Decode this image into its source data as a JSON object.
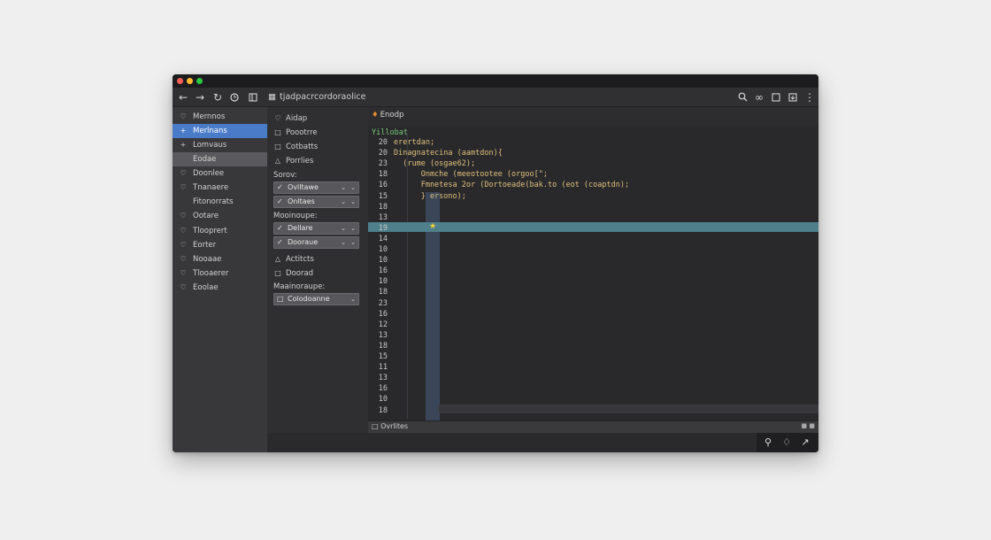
{
  "colors": {
    "accent": "#4a7bc8",
    "highlight_row": "#4e7f8a",
    "path_green": "#7ac873",
    "code_yellow": "#e0c07a",
    "star": "#f3d23a"
  },
  "toolbar": {
    "back_icon": "arrow-left-icon",
    "forward_icon": "arrow-right-icon",
    "reload_icon": "reload-icon",
    "history_icon": "clock-icon",
    "sidebar_icon": "sidebar-icon",
    "address_icon": "file-icon",
    "address": "tjadpacrcordoraolice",
    "right_icons": [
      "search-icon",
      "wand-icon",
      "square-icon",
      "download-icon",
      "more-icon"
    ]
  },
  "sidebar": {
    "items": [
      {
        "icon": "heart-icon",
        "label": "Mernnos"
      },
      {
        "icon": "plus-icon",
        "label": "Merlnans"
      },
      {
        "icon": "plus-icon",
        "label": "Lomvaus"
      },
      {
        "icon": "none",
        "label": "Eodae"
      },
      {
        "icon": "heart-icon",
        "label": "Doonlee"
      },
      {
        "icon": "heart-icon",
        "label": "Tnanaere"
      },
      {
        "icon": "none",
        "label": "Fitonorrats"
      },
      {
        "icon": "heart-icon",
        "label": "Ootare"
      },
      {
        "icon": "heart-icon",
        "label": "Tlooprert"
      },
      {
        "icon": "heart-icon",
        "label": "Eorter"
      },
      {
        "icon": "heart-icon",
        "label": "Nooaae"
      },
      {
        "icon": "heart-icon",
        "label": "Tlooaerer"
      },
      {
        "icon": "heart-icon",
        "label": "Eoolae"
      }
    ]
  },
  "panel": {
    "items": [
      {
        "icon": "heart-icon",
        "label": "Aidap"
      },
      {
        "icon": "doc-icon",
        "label": "Poootrre"
      },
      {
        "icon": "doc-icon",
        "label": "Cotbatts"
      },
      {
        "icon": "triangle-icon",
        "label": "Porrlies"
      }
    ],
    "section1": "Sorov:",
    "selects1": [
      {
        "value": "Ovlltawe"
      },
      {
        "value": "Onltaes"
      }
    ],
    "section2": "Mooinoupe:",
    "selects2": [
      {
        "value": "Dellare"
      },
      {
        "value": "Dooraue"
      }
    ],
    "items2": [
      {
        "icon": "triangle-icon",
        "label": "Actitcts"
      },
      {
        "icon": "doc-icon",
        "label": "Doorad"
      }
    ],
    "section3": "Maainoraupe:",
    "select3": {
      "value": "Colodoanne"
    }
  },
  "editor": {
    "tab": "Enodp",
    "path": "Yillobat",
    "lines": [
      {
        "n": "20",
        "code": "erertdan;"
      },
      {
        "n": "20",
        "code": "Dinagnatecina (aamtdon){"
      },
      {
        "n": "23",
        "code": "  (rume (osgae62);"
      },
      {
        "n": "18",
        "code": "      Onmche (meeotootee (orgoo[\";"
      },
      {
        "n": "16",
        "code": "      Fmnetesa 2or (Dortoeade(bak.to (eot (coaptdn);"
      },
      {
        "n": "15",
        "code": "      } ersono);"
      },
      {
        "n": "18",
        "code": ""
      },
      {
        "n": "13",
        "code": ""
      },
      {
        "n": "19",
        "code": ""
      },
      {
        "n": "14",
        "code": ""
      },
      {
        "n": "10",
        "code": ""
      },
      {
        "n": "10",
        "code": ""
      },
      {
        "n": "16",
        "code": ""
      },
      {
        "n": "10",
        "code": ""
      },
      {
        "n": "18",
        "code": ""
      },
      {
        "n": "23",
        "code": ""
      },
      {
        "n": "16",
        "code": ""
      },
      {
        "n": "12",
        "code": ""
      },
      {
        "n": "13",
        "code": ""
      },
      {
        "n": "18",
        "code": ""
      },
      {
        "n": "15",
        "code": ""
      },
      {
        "n": "11",
        "code": ""
      },
      {
        "n": "13",
        "code": ""
      },
      {
        "n": "16",
        "code": ""
      },
      {
        "n": "10",
        "code": ""
      },
      {
        "n": "18",
        "code": ""
      }
    ],
    "status_label": "Ovrlites"
  },
  "statusbar": {
    "icons": [
      "person-icon",
      "bell-icon",
      "share-icon"
    ]
  }
}
